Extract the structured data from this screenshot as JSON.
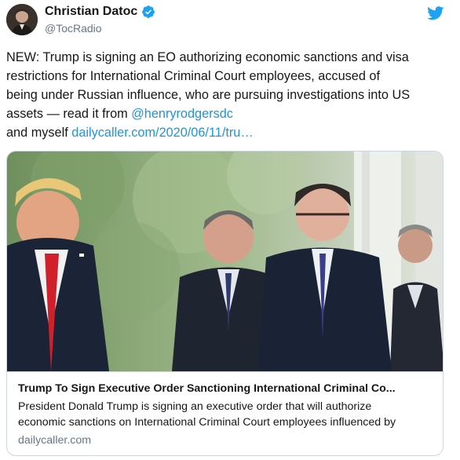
{
  "author": {
    "name": "Christian Datoc",
    "handle": "@TocRadio",
    "verified_icon": "verified-badge-icon"
  },
  "brand": {
    "icon": "twitter-bird-icon",
    "color": "#1da1f2"
  },
  "tweet": {
    "line1": "NEW: Trump is signing an EO authorizing economic sanctions and visa",
    "line2": "restrictions for International Criminal Court employees, accused of",
    "line3": "being under Russian influence, who are pursuing investigations into US",
    "line4_prefix": "assets — read it from ",
    "mention": "@henryrodgersdc",
    "line5_prefix": "and myself ",
    "url": "dailycaller.com/2020/06/11/tru…"
  },
  "card": {
    "title": "Trump To Sign Executive Order Sanctioning International Criminal Co...",
    "desc_line1": "President Donald Trump is signing an executive order that will authorize",
    "desc_line2": "economic sanctions on International Criminal Court employees influenced by",
    "domain": "dailycaller.com"
  },
  "colors": {
    "link": "#1b95e0",
    "secondary_text": "#657786",
    "border": "#ccd6dd"
  }
}
